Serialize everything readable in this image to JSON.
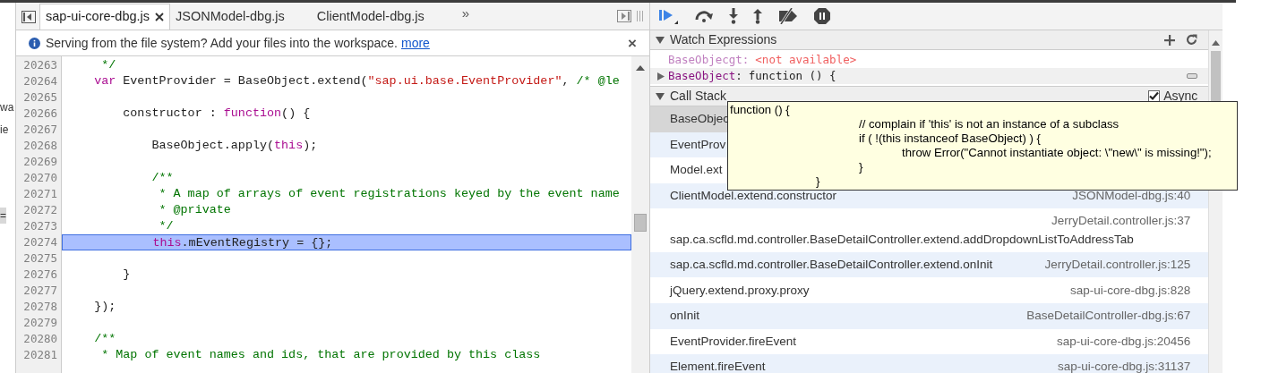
{
  "left_edge_fragments": [
    {
      "text": "wa",
      "shaded": false
    },
    {
      "text": "ie",
      "shaded": false
    },
    {
      "text": "=",
      "shaded": true
    }
  ],
  "editor_tabs": [
    {
      "label": "sap-ui-core-dbg.js",
      "selected": true,
      "closable": true
    },
    {
      "label": "JSONModel-dbg.js",
      "selected": false,
      "closable": false
    },
    {
      "label": "ClientModel-dbg.js",
      "selected": false,
      "closable": false
    }
  ],
  "more_tabs": "»",
  "infobar": {
    "message": "Serving from the file system? Add your files into the workspace.",
    "link": "more",
    "close": "×"
  },
  "code_lines": [
    {
      "number": "20263",
      "highlighted": false,
      "tokens": [
        {
          "kind": "comment",
          "text": "     */"
        }
      ]
    },
    {
      "number": "20264",
      "highlighted": false,
      "tokens": [
        {
          "kind": "keyword",
          "text": "    var"
        },
        {
          "kind": "plain",
          "text": " EventProvider = BaseObject.extend("
        },
        {
          "kind": "string",
          "text": "\"sap.ui.base.EventProvider\""
        },
        {
          "kind": "plain",
          "text": ", "
        },
        {
          "kind": "comment",
          "text": "/* @le"
        }
      ]
    },
    {
      "number": "20265",
      "highlighted": false
    },
    {
      "number": "20266",
      "highlighted": false,
      "tokens": [
        {
          "kind": "plain",
          "text": "        constructor : "
        },
        {
          "kind": "keyword",
          "text": "function"
        },
        {
          "kind": "plain",
          "text": "() {"
        }
      ]
    },
    {
      "number": "20267",
      "highlighted": false
    },
    {
      "number": "20268",
      "highlighted": false,
      "tokens": [
        {
          "kind": "plain",
          "text": "            BaseObject.apply("
        },
        {
          "kind": "keyword",
          "text": "this"
        },
        {
          "kind": "plain",
          "text": ");"
        }
      ]
    },
    {
      "number": "20269",
      "highlighted": false
    },
    {
      "number": "20270",
      "highlighted": false,
      "tokens": [
        {
          "kind": "comment",
          "text": "            /**"
        }
      ]
    },
    {
      "number": "20271",
      "highlighted": false,
      "tokens": [
        {
          "kind": "comment",
          "text": "             * A map of arrays of event registrations keyed by the event name"
        }
      ]
    },
    {
      "number": "20272",
      "highlighted": false,
      "tokens": [
        {
          "kind": "comment",
          "text": "             * @private"
        }
      ]
    },
    {
      "number": "20273",
      "highlighted": false,
      "tokens": [
        {
          "kind": "comment",
          "text": "             */"
        }
      ]
    },
    {
      "number": "20274",
      "highlighted": true,
      "tokens": [
        {
          "kind": "keyword",
          "text": "            this"
        },
        {
          "kind": "plain",
          "text": ".mEventRegistry = {};"
        }
      ]
    },
    {
      "number": "20275",
      "highlighted": false
    },
    {
      "number": "20276",
      "highlighted": false,
      "tokens": [
        {
          "kind": "plain",
          "text": "        }"
        }
      ]
    },
    {
      "number": "20277",
      "highlighted": false
    },
    {
      "number": "20278",
      "highlighted": false,
      "tokens": [
        {
          "kind": "plain",
          "text": "    });"
        }
      ]
    },
    {
      "number": "20279",
      "highlighted": false
    },
    {
      "number": "20280",
      "highlighted": false,
      "tokens": [
        {
          "kind": "comment",
          "text": "    /**"
        }
      ]
    },
    {
      "number": "20281",
      "highlighted": false,
      "tokens": [
        {
          "kind": "comment",
          "text": "     * Map of event names and ids, that are provided by this class"
        }
      ]
    }
  ],
  "watch": {
    "title": "Watch Expressions",
    "expanded": true,
    "items": [
      {
        "name": "BaseObjecgt",
        "separator": ":",
        "value": "<not available>",
        "available": false,
        "expandable": false
      },
      {
        "name": "BaseObject",
        "separator": ":",
        "value": "function () {",
        "available": true,
        "expandable": true
      }
    ]
  },
  "call_stack": {
    "title": "Call Stack",
    "expanded": true,
    "async": {
      "label": "Async",
      "checked": true
    },
    "frames": [
      {
        "kind": "single",
        "function": "BaseObjec",
        "selected": true
      },
      {
        "kind": "single",
        "function": "EventProv",
        "selected": false
      },
      {
        "kind": "single",
        "function": "Model.ext",
        "selected": false
      },
      {
        "kind": "single",
        "function": "ClientModel.extend.constructor",
        "file": "JSONModel-dbg.js:40",
        "selected": false
      },
      {
        "kind": "wrapped",
        "function": "sap.ca.scfld.md.controller.BaseDetailController.extend.addDropdownListToAddressTab",
        "file": "JerryDetail.controller.js:37",
        "selected": false
      },
      {
        "kind": "single",
        "function": "sap.ca.scfld.md.controller.BaseDetailController.extend.onInit",
        "file": "JerryDetail.controller.js:125",
        "selected": false
      },
      {
        "kind": "single",
        "function": "jQuery.extend.proxy.proxy",
        "file": "sap-ui-core-dbg.js:828",
        "selected": false
      },
      {
        "kind": "single",
        "function": "onInit",
        "file": "BaseDetailController-dbg.js:67",
        "selected": false
      },
      {
        "kind": "single",
        "function": "EventProvider.fireEvent",
        "file": "sap-ui-core-dbg.js:20456",
        "selected": false
      },
      {
        "kind": "single",
        "function": "Element.fireEvent",
        "file": "sap-ui-core-dbg.js:31137",
        "selected": false
      }
    ]
  },
  "tooltip": {
    "lines": [
      "function () {",
      "\t\t\t// complain if 'this' is not an instance of a subclass",
      "\t\t\tif ( !(this instanceof BaseObject) ) {",
      "\t\t\t\tthrow Error(\"Cannot instantiate object: \\\"new\\\" is missing!\");",
      "\t\t\t}",
      "\t\t}"
    ]
  }
}
